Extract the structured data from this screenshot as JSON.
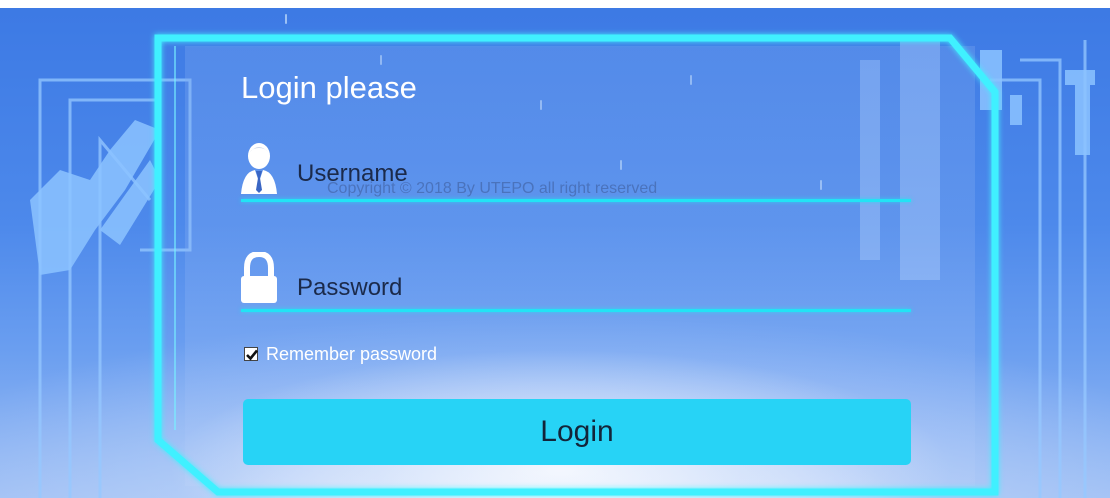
{
  "login_panel": {
    "title": "Login please",
    "username": {
      "placeholder": "Username",
      "icon": "user-icon"
    },
    "password": {
      "placeholder": "Password",
      "icon": "lock-icon"
    },
    "copyright": "Copyright © 2018 By UTEPO all right reserved",
    "remember": {
      "label": "Remember password",
      "checked": true
    },
    "login_button": {
      "label": "Login"
    }
  },
  "colors": {
    "accent_cyan": "#22e3f5",
    "button_bg": "#27d3f6",
    "background_blue": "#3c79e4"
  }
}
